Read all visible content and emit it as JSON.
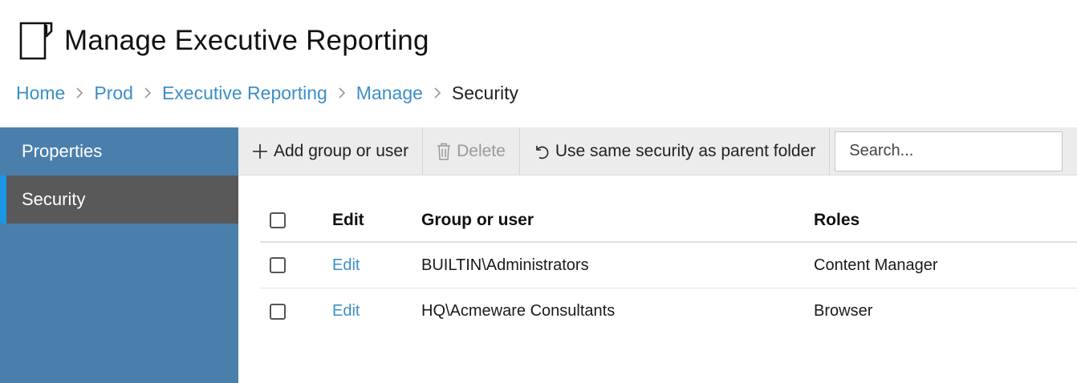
{
  "header": {
    "title": "Manage Executive Reporting",
    "icon": "report-icon"
  },
  "breadcrumb": {
    "items": [
      {
        "label": "Home"
      },
      {
        "label": "Prod"
      },
      {
        "label": "Executive Reporting"
      },
      {
        "label": "Manage"
      }
    ],
    "current": "Security"
  },
  "sidebar": {
    "items": [
      {
        "label": "Properties",
        "active": false
      },
      {
        "label": "Security",
        "active": true
      }
    ],
    "colors": {
      "background": "#4a7fac",
      "active_background": "#595959",
      "active_accent": "#1b95e6"
    }
  },
  "toolbar": {
    "add_label": "Add group or user",
    "delete_label": "Delete",
    "revert_label": "Use same security as parent folder",
    "search_placeholder": "Search..."
  },
  "table": {
    "columns": {
      "edit": "Edit",
      "user": "Group or user",
      "roles": "Roles"
    },
    "rows": [
      {
        "edit": "Edit",
        "user": "BUILTIN\\Administrators",
        "roles": "Content Manager"
      },
      {
        "edit": "Edit",
        "user": "HQ\\Acmeware Consultants",
        "roles": "Browser"
      }
    ]
  },
  "colors": {
    "link": "#3b8fc6"
  }
}
